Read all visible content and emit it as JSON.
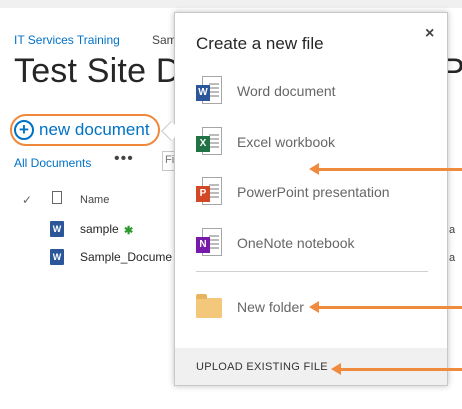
{
  "breadcrumb": {
    "site": "IT Services Training",
    "next_partial": "Sam"
  },
  "page": {
    "title": "Test Site Do",
    "title_tail": "P"
  },
  "toolbar": {
    "new_document_label": "new document",
    "plus_glyph": "+"
  },
  "views": {
    "all_documents": "All Documents",
    "more": "•••",
    "find_partial": "Fi"
  },
  "list": {
    "header_check": "✓",
    "header_name": "Name",
    "rows": [
      {
        "name": "sample",
        "icon_letter": "W",
        "new_marker": "✱",
        "right": "a"
      },
      {
        "name": "Sample_Docume",
        "icon_letter": "W",
        "right": "a"
      }
    ]
  },
  "callout": {
    "title": "Create a new file",
    "close": "×",
    "items": [
      {
        "label": "Word document",
        "icon": "word-icon",
        "letter": "W",
        "color": "#2b579a"
      },
      {
        "label": "Excel workbook",
        "icon": "excel-icon",
        "letter": "X",
        "color": "#217346"
      },
      {
        "label": "PowerPoint presentation",
        "icon": "powerpoint-icon",
        "letter": "P",
        "color": "#d24726"
      },
      {
        "label": "OneNote notebook",
        "icon": "onenote-icon",
        "letter": "N",
        "color": "#7719aa"
      }
    ],
    "new_folder": "New folder",
    "upload": "UPLOAD EXISTING FILE"
  },
  "colors": {
    "accent": "#0072c6",
    "annotation": "#f08a3c"
  }
}
